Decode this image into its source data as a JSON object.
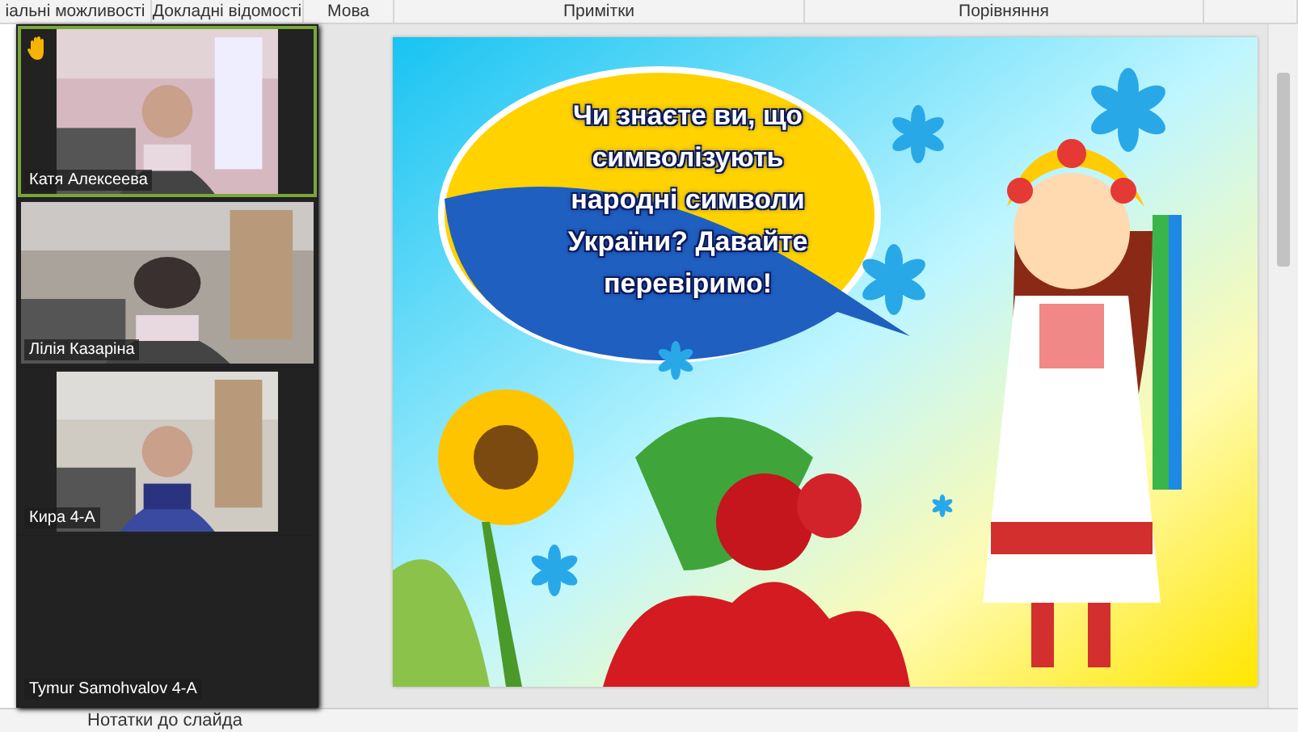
{
  "ribbon": {
    "groups": [
      "іальні можливості",
      "Докладні відомості",
      "Мова",
      "Примітки",
      "Порівняння"
    ]
  },
  "video_panel": {
    "participants": [
      {
        "name": "Катя Алексеева",
        "raised_hand": true,
        "speaking": true,
        "video": true
      },
      {
        "name": "Лілія Казаріна",
        "raised_hand": false,
        "speaking": false,
        "video": true
      },
      {
        "name": "Кира 4-А",
        "raised_hand": false,
        "speaking": false,
        "video": true
      },
      {
        "name": "Tymur Samohvalov 4-A",
        "raised_hand": false,
        "speaking": false,
        "video": false
      }
    ]
  },
  "slide": {
    "text": "Чи знаєте ви, що символізують народні символи України? Давайте перевіримо!"
  },
  "notes": {
    "label": "Нотатки до слайда"
  }
}
